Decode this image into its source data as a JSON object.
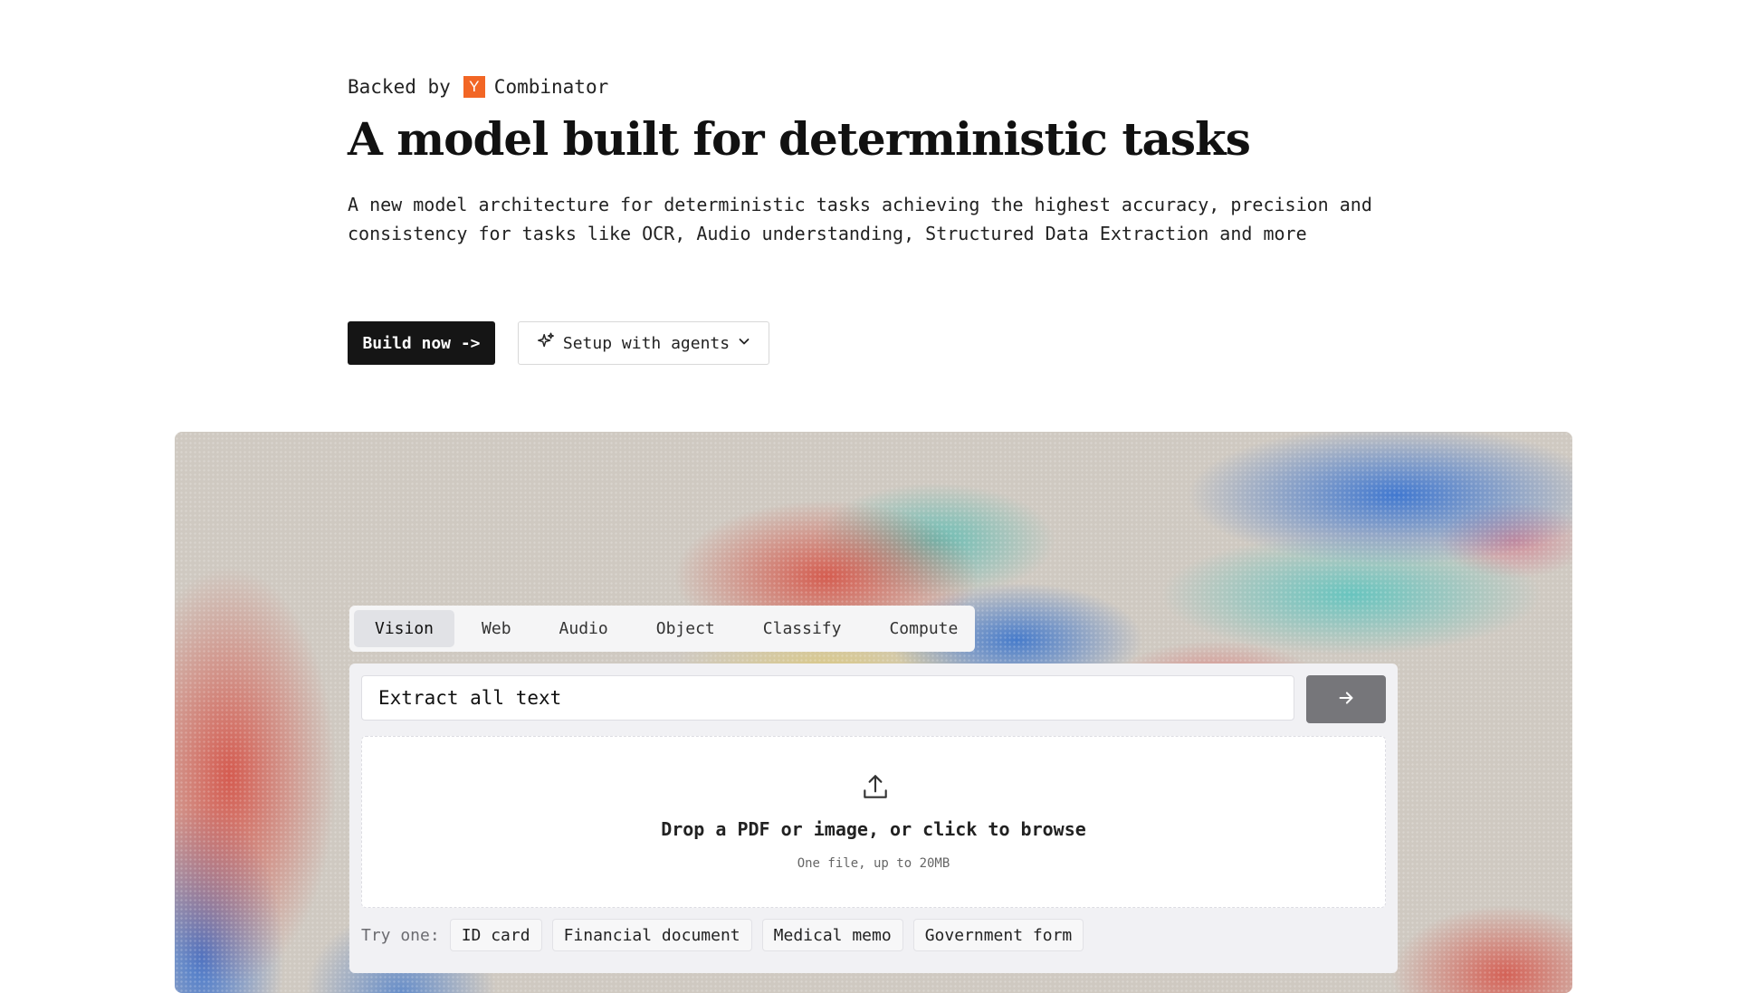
{
  "hero": {
    "backed_prefix": "Backed by",
    "yc_logo_letter": "Y",
    "backed_suffix": "Combinator",
    "title": "A model built for deterministic tasks",
    "description": "A new model architecture for deterministic tasks achieving the highest accuracy, precision and consistency for tasks like OCR, Audio understanding, Structured Data Extraction and more",
    "build_button": "Build now ->",
    "setup_button": "Setup with agents",
    "yc_color": "#f26625"
  },
  "demo": {
    "tabs": [
      {
        "label": "Vision",
        "active": true
      },
      {
        "label": "Web",
        "active": false
      },
      {
        "label": "Audio",
        "active": false
      },
      {
        "label": "Object",
        "active": false
      },
      {
        "label": "Classify",
        "active": false
      },
      {
        "label": "Compute",
        "active": false
      }
    ],
    "prompt_value": "Extract all text",
    "dropzone_title": "Drop a PDF or image, or click to browse",
    "dropzone_subtitle": "One file, up to 20MB",
    "try_label": "Try one:",
    "examples": [
      "ID card",
      "Financial document",
      "Medical memo",
      "Government form"
    ]
  },
  "icons": {
    "sparkle": "sparkle-icon",
    "chevron": "chevron-down-icon",
    "arrow": "arrow-right-icon",
    "upload": "upload-icon"
  }
}
